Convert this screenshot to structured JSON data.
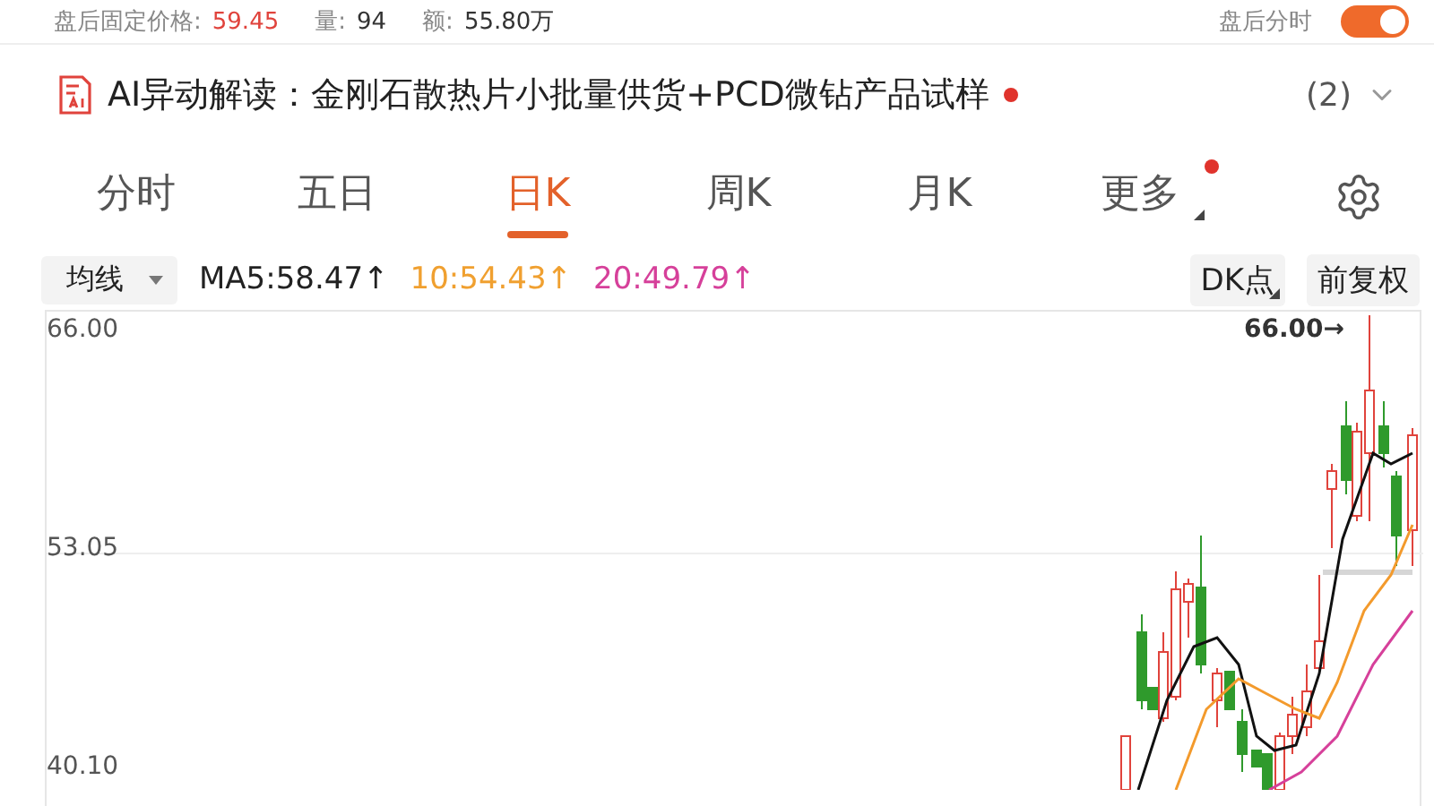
{
  "after_hours": {
    "items": [
      {
        "label": "盘后固定价格:",
        "value": "59.45"
      },
      {
        "label": "量:",
        "value": "94"
      },
      {
        "label": "额:",
        "value": "55.80万"
      }
    ],
    "toggle_label": "盘后分时",
    "toggle_on": true
  },
  "ai_reading": {
    "label": "AI异动解读：金刚石散热片小批量供货+PCD微钻产品试样",
    "unread": true,
    "count": "(2)"
  },
  "tabs": [
    {
      "label": "分时",
      "selected": false,
      "badge": false
    },
    {
      "label": "五日",
      "selected": false,
      "badge": false
    },
    {
      "label": "日K",
      "selected": true,
      "badge": false
    },
    {
      "label": "周K",
      "selected": false,
      "badge": false
    },
    {
      "label": "月K",
      "selected": false,
      "badge": false
    },
    {
      "label": "更多",
      "selected": false,
      "badge": true
    }
  ],
  "indicators": {
    "selector": "均线",
    "values": [
      {
        "text": "MA5:58.47↑",
        "color": "#222222"
      },
      {
        "text": "10:54.43↑",
        "color": "#f0a030"
      },
      {
        "text": "20:49.79↑",
        "color": "#d6409a"
      }
    ],
    "buttons": [
      "DK点",
      "前复权"
    ]
  },
  "chart": {
    "y_labels": [
      "66.00",
      "53.05",
      "40.10"
    ],
    "high_label": "66.00→"
  }
}
